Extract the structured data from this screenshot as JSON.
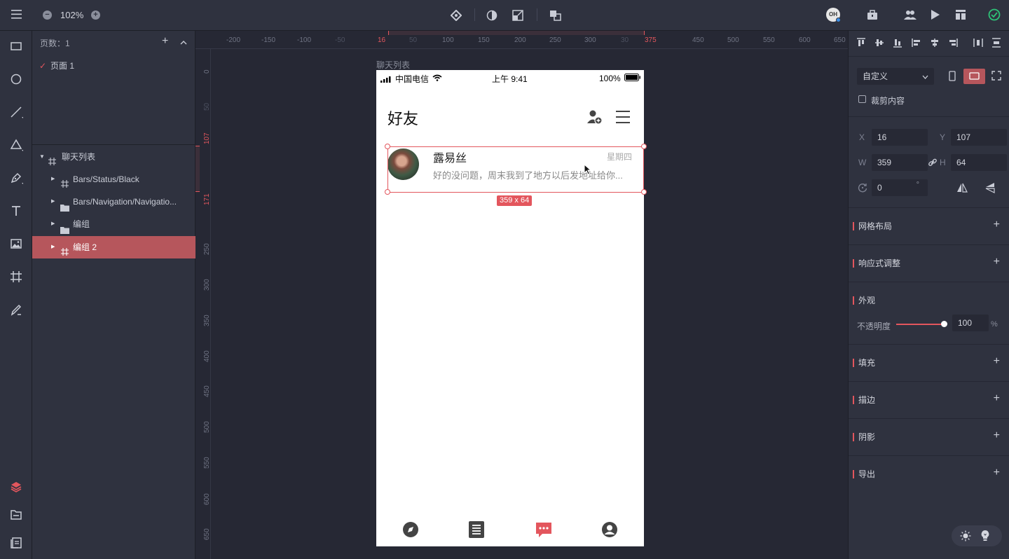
{
  "topbar": {
    "zoom": "102%",
    "avatar": "OH"
  },
  "layers": {
    "pages_label": "页数：1",
    "page_name": "页面 1",
    "items": [
      {
        "label": "聊天列表",
        "kind": "artboard"
      },
      {
        "label": "Bars/Status/Black",
        "kind": "artboard"
      },
      {
        "label": "Bars/Navigation/Navigatio...",
        "kind": "folder"
      },
      {
        "label": "编组",
        "kind": "folder"
      },
      {
        "label": "编组 2",
        "kind": "artboard"
      }
    ]
  },
  "ruler": {
    "h_ticks": [
      "-200",
      "-150",
      "-100",
      "-50",
      "16",
      "50",
      "100",
      "150",
      "200",
      "250",
      "300",
      "30",
      "375",
      "450",
      "500",
      "550",
      "600",
      "650"
    ],
    "v_ticks": [
      "0",
      "50",
      "107",
      "171",
      "250",
      "300",
      "350",
      "400",
      "450",
      "500",
      "550",
      "600",
      "650"
    ]
  },
  "canvas": {
    "artboard_label": "聊天列表",
    "selection_size": "359 x 64",
    "status": {
      "carrier": "中国电信",
      "time": "上午 9:41",
      "battery": "100%"
    },
    "header_title": "好友",
    "chat": {
      "name": "露易丝",
      "day": "星期四",
      "message": "好的没问题，周末我到了地方以后发地址给你..."
    }
  },
  "right": {
    "preset": "自定义",
    "clip_label": "裁剪内容",
    "x_label": "X",
    "x": "16",
    "y_label": "Y",
    "y": "107",
    "w_label": "W",
    "w": "359",
    "h_label": "H",
    "h": "64",
    "rotation": "0",
    "rotation_unit": "°",
    "sections": {
      "grid": "网格布局",
      "responsive": "响应式调整",
      "appearance": "外观",
      "fill": "填充",
      "stroke": "描边",
      "shadow": "阴影",
      "export": "导出"
    },
    "opacity_label": "不透明度",
    "opacity": "100",
    "opacity_unit": "%",
    "opacity_level": 1.0
  },
  "colors": {
    "accent": "#e3565d",
    "panel": "#2f323f",
    "canvas": "#262834",
    "selected_row": "#b6565c"
  }
}
